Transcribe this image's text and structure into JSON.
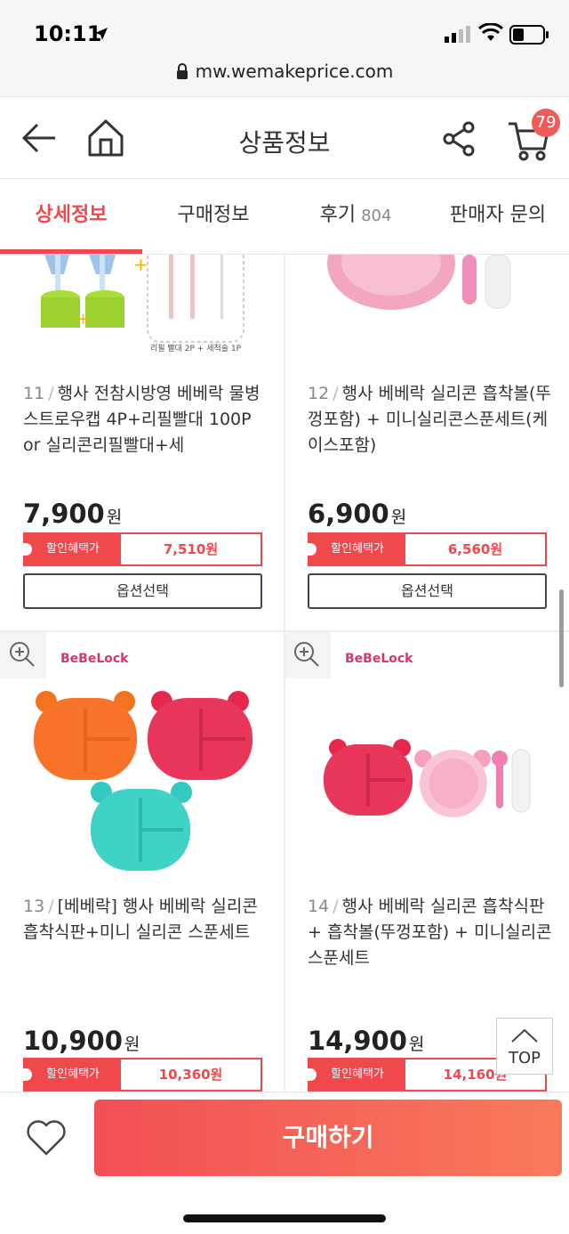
{
  "status": {
    "time": "10:11",
    "url": "mw.wemakeprice.com"
  },
  "header": {
    "title": "상품정보",
    "cart_count": "79"
  },
  "tabs": [
    {
      "label": "상세정보"
    },
    {
      "label": "구매정보"
    },
    {
      "label": "후기",
      "count": "804"
    },
    {
      "label": "판매자 문의"
    }
  ],
  "products": [
    {
      "num": "11",
      "name": "행사 전참시방영 베베락 물병스트로우캡 4P+리필빨대 100P or 실리콘리필빨대+세",
      "price": "7,900",
      "won": "원",
      "disc_label": "할인혜택가",
      "disc_price": "7,510원",
      "option": "옵션선택",
      "img_caption": "리필 빨대 2P + 세척솔 1P"
    },
    {
      "num": "12",
      "name": "행사 베베락 실리콘 흡착볼(뚜껑포함) + 미니실리콘스푼세트(케이스포함)",
      "price": "6,900",
      "won": "원",
      "disc_label": "할인혜택가",
      "disc_price": "6,560원",
      "option": "옵션선택"
    },
    {
      "num": "13",
      "name": "[베베락] 행사 베베락 실리콘 흡착식판+미니 실리콘 스푼세트",
      "price": "10,900",
      "won": "원",
      "disc_label": "할인혜택가",
      "disc_price": "10,360원",
      "brand": "BeBeLock"
    },
    {
      "num": "14",
      "name": "행사 베베락 실리콘 흡착식판 + 흡착볼(뚜껑포함) + 미니실리콘스푼세트",
      "price": "14,900",
      "won": "원",
      "disc_label": "할인혜택가",
      "disc_price": "14,160원",
      "brand": "BeBeLock"
    }
  ],
  "top_button": "TOP",
  "buy_button": "구매하기",
  "colors": {
    "accent": "#f0484d",
    "buy_start": "#f24f55",
    "buy_end": "#f97a5b"
  }
}
